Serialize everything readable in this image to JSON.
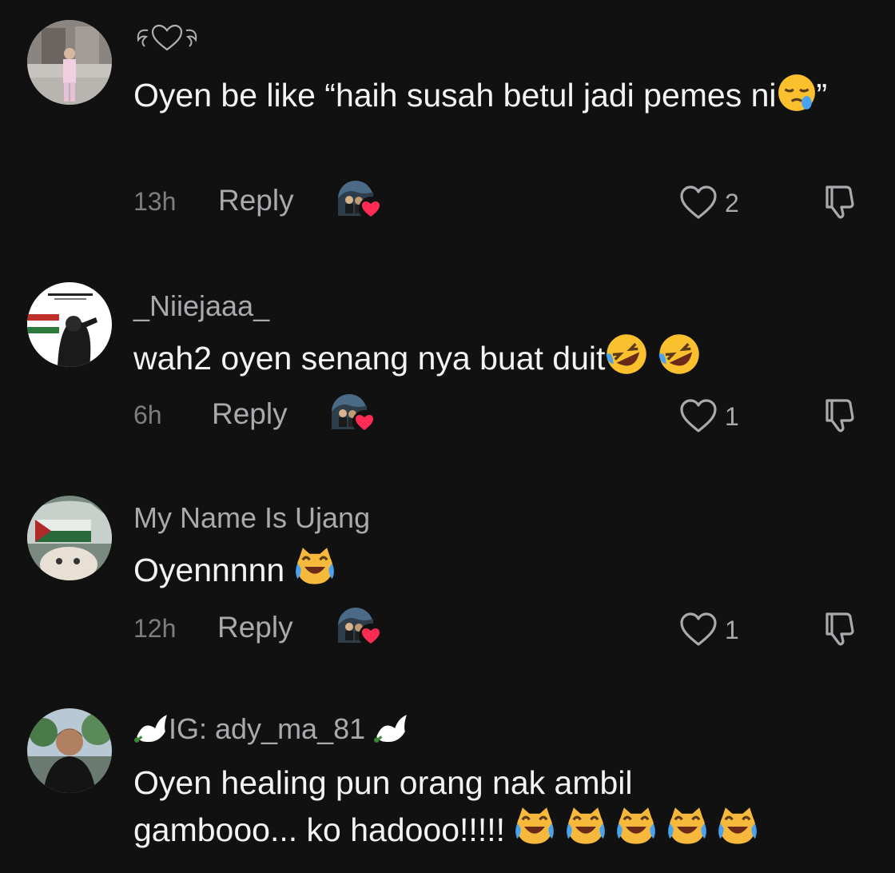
{
  "comments": [
    {
      "username": "",
      "username_decor": "heart-wings",
      "text": "Oyen be like “haih susah betul jadi pemes ni",
      "text_end": "”",
      "emojis": [
        "sleepy-face"
      ],
      "time": "13h",
      "reply_label": "Reply",
      "likes": "2"
    },
    {
      "username": "_Niiejaaa_",
      "text": "wah2 oyen senang nya buat duit",
      "emojis": [
        "rolling-on-floor-laughing",
        "rolling-on-floor-laughing"
      ],
      "time": "6h",
      "reply_label": "Reply",
      "likes": "1"
    },
    {
      "username": "My Name Is Ujang",
      "text": "Oyennnnn",
      "emojis": [
        "cat-with-tears-of-joy"
      ],
      "time": "12h",
      "reply_label": "Reply",
      "likes": "1"
    },
    {
      "username": "IG: ady_ma_81",
      "username_decor": "dove",
      "text_line1": "Oyen healing pun orang nak ambil",
      "text_line2": "gambooo... ko hadooo!!!!!",
      "emojis": [
        "cat-with-tears-of-joy",
        "cat-with-tears-of-joy",
        "cat-with-tears-of-joy",
        "cat-with-tears-of-joy",
        "cat-with-tears-of-joy"
      ]
    }
  ],
  "colors": {
    "background": "#111111",
    "primary_text": "#f3f3f3",
    "secondary_text": "#a9a9ae",
    "heart_badge": "#fe2c55"
  }
}
